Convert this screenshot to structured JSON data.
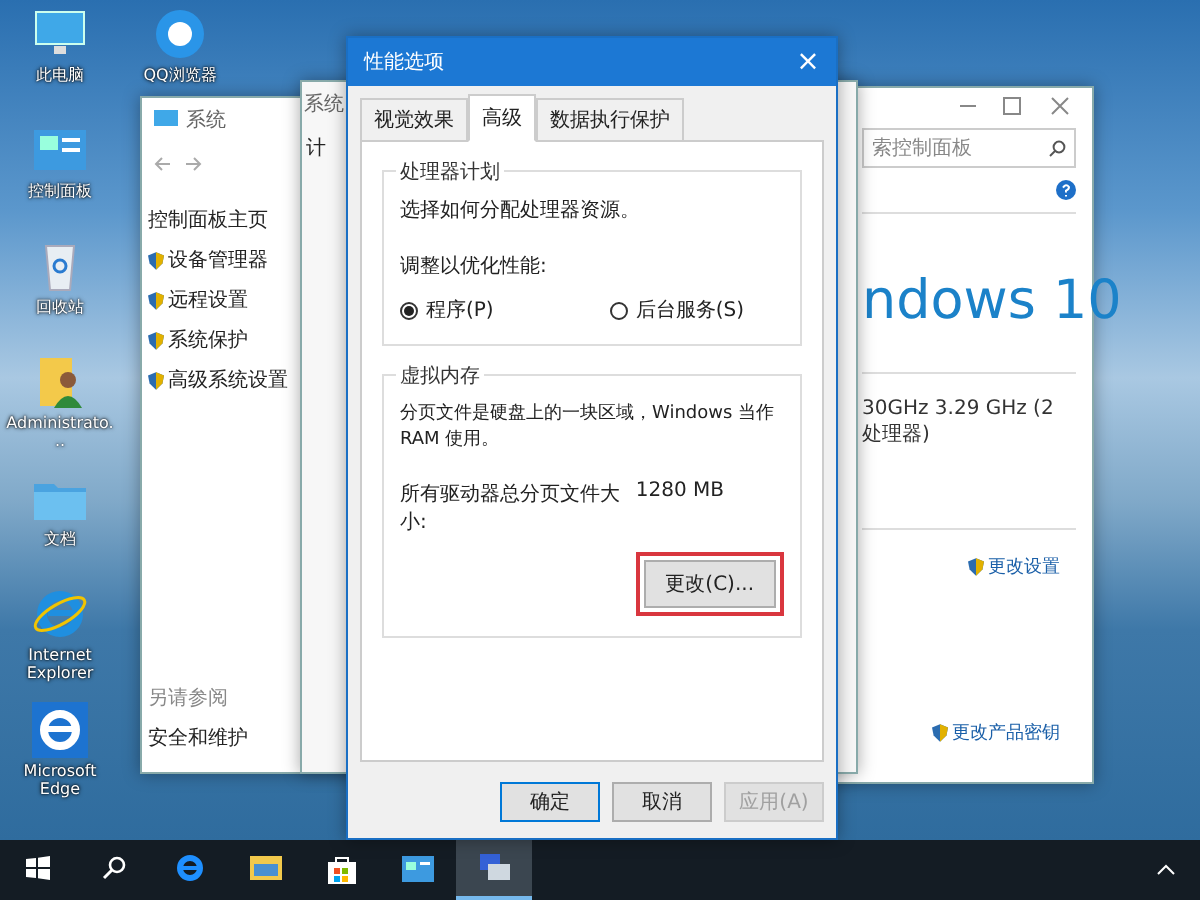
{
  "desktop_icons": [
    {
      "label": "此电脑",
      "kind": "pc"
    },
    {
      "label": "控制面板",
      "kind": "panel"
    },
    {
      "label": "回收站",
      "kind": "recycle"
    },
    {
      "label": "Administrato...",
      "kind": "user"
    },
    {
      "label": "文档",
      "kind": "folder"
    },
    {
      "label": "Internet Explorer",
      "kind": "ie"
    },
    {
      "label": "Microsoft Edge",
      "kind": "edge"
    },
    {
      "label": "QQ浏览器",
      "kind": "qq"
    }
  ],
  "system_window": {
    "title": "系统",
    "home_link": "控制面板主页",
    "links": [
      "设备管理器",
      "远程设置",
      "系统保护",
      "高级系统设置"
    ],
    "see_also": "另请参阅",
    "see_also_links": [
      "安全和维护"
    ]
  },
  "middle_window": {
    "title": "系统",
    "partial_text": "计"
  },
  "right_window": {
    "search_placeholder": "索控制面板",
    "brand": "ndows 10",
    "cpu": "30GHz  3.29 GHz (2 处理器)",
    "links": [
      "更改设置",
      "更改产品密钥"
    ]
  },
  "dialog": {
    "title": "性能选项",
    "close": "×",
    "tabs": [
      {
        "label": "视觉效果",
        "selected": false
      },
      {
        "label": "高级",
        "selected": true
      },
      {
        "label": "数据执行保护",
        "selected": false
      }
    ],
    "processor": {
      "legend": "处理器计划",
      "description": "选择如何分配处理器资源。",
      "prompt": "调整以优化性能:",
      "options": [
        {
          "label": "程序(P)",
          "selected": true
        },
        {
          "label": "后台服务(S)",
          "selected": false
        }
      ]
    },
    "memory": {
      "legend": "虚拟内存",
      "description": "分页文件是硬盘上的一块区域，Windows 当作 RAM 使用。",
      "size_label": "所有驱动器总分页文件大小:",
      "size_value": "1280 MB",
      "change_button": {
        "label": "更改(C)...",
        "highlighted": true
      }
    },
    "buttons": [
      {
        "label": "确定",
        "disabled": false,
        "default": true
      },
      {
        "label": "取消",
        "disabled": false,
        "default": false
      },
      {
        "label": "应用(A)",
        "disabled": true,
        "default": false
      }
    ]
  },
  "taskbar": {
    "items": [
      {
        "kind": "start",
        "selected": false
      },
      {
        "kind": "search",
        "selected": false
      },
      {
        "kind": "edge",
        "selected": false
      },
      {
        "kind": "explorer",
        "selected": false
      },
      {
        "kind": "store",
        "selected": false
      },
      {
        "kind": "panel",
        "selected": false
      },
      {
        "kind": "system",
        "selected": true
      }
    ]
  }
}
